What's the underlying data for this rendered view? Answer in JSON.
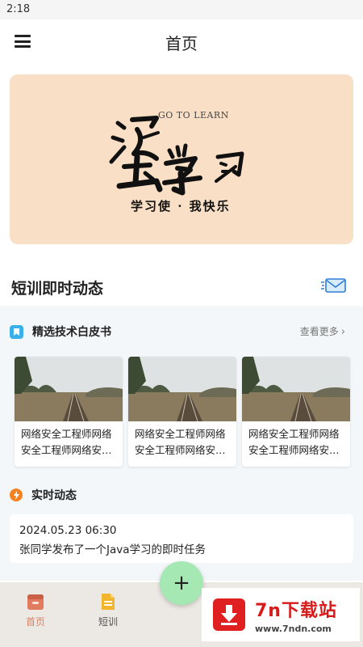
{
  "status_bar": {
    "time": "2:18"
  },
  "header": {
    "title": "首页",
    "menu_icon": "hamburger-icon"
  },
  "banner": {
    "english": "GO TO LEARN",
    "calligraphy": "滚去学习",
    "motto": "学习使 · 我快乐"
  },
  "section": {
    "title": "短训即时动态",
    "icon": "mail-icon"
  },
  "whitepaper": {
    "title": "精选技术白皮书",
    "view_more": "查看更多",
    "icon": "bookmark-icon",
    "cards": [
      {
        "text": "网络安全工程师网络安全工程师网络安全工程师"
      },
      {
        "text": "网络安全工程师网络安全工程师网络安全工程师"
      },
      {
        "text": "网络安全工程师网络安全工程师网络安全工程师"
      }
    ]
  },
  "live": {
    "title": "实时动态",
    "icon": "bolt-icon",
    "items": [
      {
        "time": "2024.05.23 06:30",
        "text": "张同学发布了一个Java学习的即时任务"
      }
    ]
  },
  "bottom_nav": {
    "items": [
      {
        "label": "首页",
        "icon": "home-icon",
        "active": true
      },
      {
        "label": "短训",
        "icon": "document-icon",
        "active": false
      }
    ],
    "fab": "+"
  },
  "watermark": {
    "title": "7n下载站",
    "url": "www.7ndn.com"
  },
  "colors": {
    "banner_bg": "#f9dfc6",
    "accent_active": "#d88266",
    "fab": "#a6e8b3",
    "panel_bg": "#f3f7fa",
    "watermark_red": "#d71a1a"
  }
}
